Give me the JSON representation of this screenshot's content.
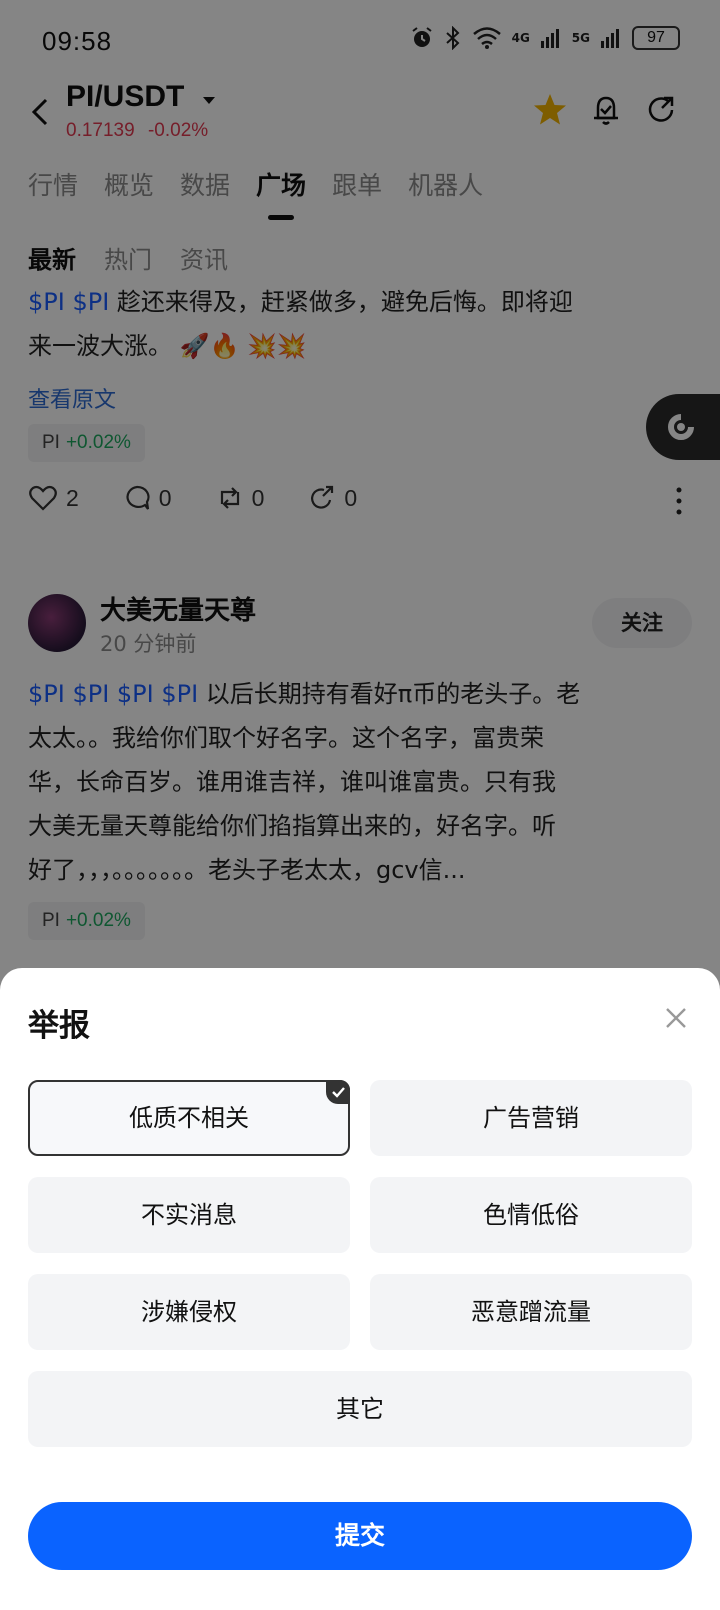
{
  "status_bar": {
    "time": "09:58",
    "network_4g": "4G",
    "network_5g": "5G",
    "battery": "97"
  },
  "header": {
    "pair": "PI/USDT",
    "price": "0.17139",
    "change": "-0.02%"
  },
  "tabs": [
    {
      "label": "行情"
    },
    {
      "label": "概览"
    },
    {
      "label": "数据"
    },
    {
      "label": "广场",
      "active": true
    },
    {
      "label": "跟单"
    },
    {
      "label": "机器人"
    }
  ],
  "subtabs": [
    {
      "label": "最新",
      "active": true
    },
    {
      "label": "热门"
    },
    {
      "label": "资讯"
    }
  ],
  "post1": {
    "hashtags": "$PI $PI",
    "text_line1": " 趁还来得及，赶紧做多，避免后悔。即将迎",
    "text_line2": "来一波大涨。 🚀🔥 💥💥",
    "view_original": "查看原文",
    "coin": {
      "symbol": "PI",
      "change": "+0.02%"
    },
    "likes": "2",
    "comments": "0",
    "reposts": "0",
    "shares": "0"
  },
  "post2": {
    "author": "大美无量天尊",
    "time": "20 分钟前",
    "follow": "关注",
    "hashtags": "$PI $PI $PI $PI",
    "text_line1": " 以后长期持有看好π币的老头子。老",
    "text_line2": "太太。。我给你们取个好名字。这个名字，富贵荣",
    "text_line3": "华，长命百岁。谁用谁吉祥，谁叫谁富贵。只有我",
    "text_line4": "大美无量天尊能给你们掐指算出来的，好名字。听",
    "text_line5": "好了，，，。。。。。。。老头子老太太，gcv信...",
    "coin": {
      "symbol": "PI",
      "change": "+0.02%"
    }
  },
  "report_sheet": {
    "title": "举报",
    "options": [
      {
        "label": "低质不相关",
        "selected": true
      },
      {
        "label": "广告营销"
      },
      {
        "label": "不实消息"
      },
      {
        "label": "色情低俗"
      },
      {
        "label": "涉嫌侵权"
      },
      {
        "label": "恶意蹭流量"
      },
      {
        "label": "其它"
      }
    ],
    "submit": "提交"
  },
  "colors": {
    "accent": "#0a63ff",
    "negative": "#e23b52",
    "positive": "#1ea85f",
    "star": "#f2b300",
    "hashtag": "#1a5cff"
  }
}
